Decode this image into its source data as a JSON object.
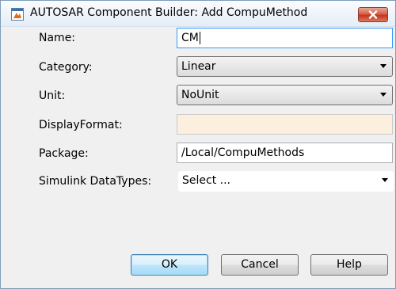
{
  "window": {
    "title": "AUTOSAR Component Builder: Add CompuMethod"
  },
  "form": {
    "name": {
      "label": "Name:",
      "value": "CM"
    },
    "category": {
      "label": "Category:",
      "value": "Linear"
    },
    "unit": {
      "label": "Unit:",
      "value": "NoUnit"
    },
    "display_format": {
      "label": "DisplayFormat:",
      "value": ""
    },
    "package": {
      "label": "Package:",
      "value": "/Local/CompuMethods"
    },
    "simulink_datatypes": {
      "label": "Simulink DataTypes:",
      "value": "Select ..."
    }
  },
  "buttons": {
    "ok": "OK",
    "cancel": "Cancel",
    "help": "Help"
  },
  "colors": {
    "title_gradient_top": "#fafcff",
    "close_button": "#c2361d",
    "display_format_bg": "#fdefdd",
    "focus_border": "#3399ff"
  },
  "icons": {
    "app": "matlab-window-icon",
    "close": "close-icon",
    "dropdown": "chevron-down-icon"
  }
}
